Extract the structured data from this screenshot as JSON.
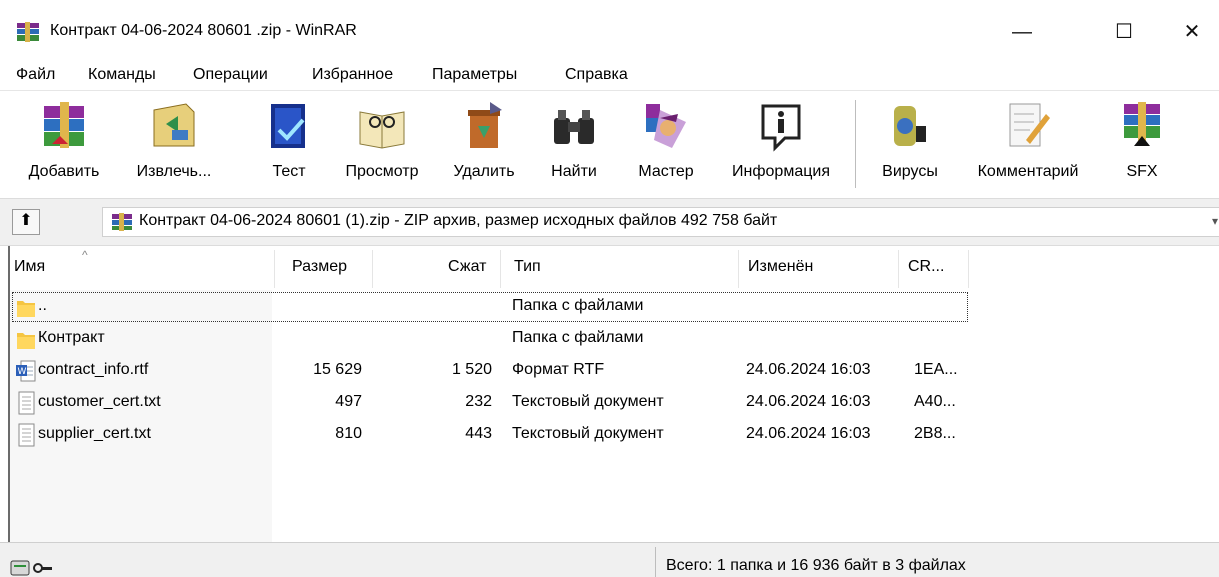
{
  "window": {
    "title": "Контракт 04-06-2024 80601 .zip - WinRAR",
    "minimize_glyph": "—",
    "maximize_glyph": "☐",
    "close_glyph": "✕"
  },
  "menu": [
    "Файл",
    "Команды",
    "Операции",
    "Избранное",
    "Параметры",
    "Справка"
  ],
  "toolbar": [
    {
      "label": "Добавить",
      "icon": "add-archive-icon"
    },
    {
      "label": "Извлечь...",
      "icon": "extract-icon"
    },
    {
      "label": "Тест",
      "icon": "test-icon"
    },
    {
      "label": "Просмотр",
      "icon": "view-icon"
    },
    {
      "label": "Удалить",
      "icon": "delete-icon"
    },
    {
      "label": "Найти",
      "icon": "find-icon"
    },
    {
      "label": "Мастер",
      "icon": "wizard-icon"
    },
    {
      "label": "Информация",
      "icon": "info-icon"
    },
    {
      "label": "Вирусы",
      "icon": "virus-scan-icon"
    },
    {
      "label": "Комментарий",
      "icon": "comment-icon"
    },
    {
      "label": "SFX",
      "icon": "sfx-icon"
    }
  ],
  "address": {
    "up_glyph": "⬆",
    "path": "Контракт 04-06-2024 80601 (1).zip - ZIP архив, размер исходных файлов 492 758 байт"
  },
  "columns": {
    "name": "Имя",
    "size": "Размер",
    "packed": "Сжат",
    "type": "Тип",
    "modified": "Изменён",
    "crc": "CR..."
  },
  "rows": [
    {
      "name": "..",
      "size": "",
      "packed": "",
      "type": "Папка с файлами",
      "modified": "",
      "crc": "",
      "icon": "folder-icon"
    },
    {
      "name": "Контракт",
      "size": "",
      "packed": "",
      "type": "Папка с файлами",
      "modified": "",
      "crc": "",
      "icon": "folder-icon"
    },
    {
      "name": "contract_info.rtf",
      "size": "15 629",
      "packed": "1 520",
      "type": "Формат RTF",
      "modified": "24.06.2024 16:03",
      "crc": "1EA...",
      "icon": "word-document-icon"
    },
    {
      "name": "customer_cert.txt",
      "size": "497",
      "packed": "232",
      "type": "Текстовый документ",
      "modified": "24.06.2024 16:03",
      "crc": "A40...",
      "icon": "text-file-icon"
    },
    {
      "name": "supplier_cert.txt",
      "size": "810",
      "packed": "443",
      "type": "Текстовый документ",
      "modified": "24.06.2024 16:03",
      "crc": "2B8...",
      "icon": "text-file-icon"
    }
  ],
  "status": {
    "summary": "Всего: 1 папка и 16 936 байт в 3 файлах"
  }
}
